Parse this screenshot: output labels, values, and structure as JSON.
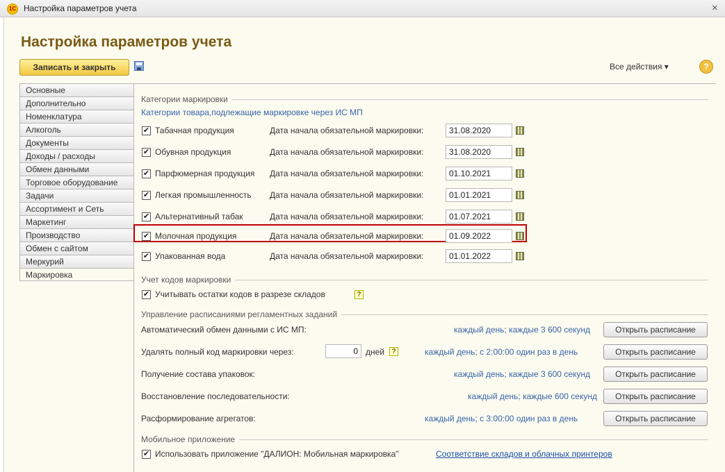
{
  "window": {
    "title": "Настройка параметров учета",
    "close_glyph": "×",
    "logo_text": "1С"
  },
  "form": {
    "title": "Настройка параметров учета"
  },
  "toolbar": {
    "save_close_label": "Записать и закрыть",
    "all_actions_label": "Все действия ▾",
    "help_glyph": "?"
  },
  "tabs": [
    "Основные",
    "Дополнительно",
    "Номенклатура",
    "Алкоголь",
    "Документы",
    "Доходы / расходы",
    "Обмен данными",
    "Торговое оборудование",
    "Задачи",
    "Ассортимент и Сеть",
    "Маркетинг",
    "Производство",
    "Обмен с сайтом",
    "Меркурий",
    "Маркировка"
  ],
  "active_tab": "Маркировка",
  "marking": {
    "section_title": "Категории маркировки",
    "subtitle": "Категории товара,подлежащие маркировке через ИС МП",
    "date_label": "Дата начала обязательной маркировки:",
    "categories": [
      {
        "label": "Табачная продукция",
        "checked": true,
        "date": "31.08.2020"
      },
      {
        "label": "Обувная продукция",
        "checked": true,
        "date": "31.08.2020"
      },
      {
        "label": "Парфюмерная продукция",
        "checked": true,
        "date": "01.10.2021"
      },
      {
        "label": "Легкая промышленность",
        "checked": true,
        "date": "01.01.2021"
      },
      {
        "label": "Альтернативный табак",
        "checked": true,
        "date": "01.07.2021"
      },
      {
        "label": "Молочная продукция",
        "checked": true,
        "date": "01.09.2022"
      },
      {
        "label": "Упакованная вода",
        "checked": true,
        "date": "01.01.2022"
      }
    ]
  },
  "codes": {
    "section_title": "Учет кодов маркировки",
    "checkbox_label": "Учитывать остатки кодов в разрезе складов",
    "checked": true
  },
  "schedules": {
    "section_title": "Управление расписаниями регламентных заданий",
    "button_label": "Открыть расписание",
    "delete_value": "0",
    "days_label": "дней",
    "rows": [
      {
        "label": "Автоматический обмен данными с ИС МП:",
        "schedule": "каждый день; каждые 3 600 секунд"
      },
      {
        "label": "Удалять полный код маркировки через:",
        "schedule": "каждый день; с 2:00:00 один раз в день"
      },
      {
        "label": "Получение состава упаковок:",
        "schedule": "каждый день; каждые 3 600 секунд"
      },
      {
        "label": "Восстановление последовательности:",
        "schedule": "каждый день; каждые 600 секунд"
      },
      {
        "label": "Расформирование агрегатов:",
        "schedule": "каждый день; с 3:00:00 один раз в день"
      }
    ]
  },
  "mobile": {
    "section_title": "Мобильное приложение",
    "checkbox_label": "Использовать приложение \"ДАЛИОН: Мобильная маркировка\"",
    "checked": true,
    "link_label": "Соответствие складов и облачных принтеров"
  },
  "glyphs": {
    "check": "✔"
  },
  "icons": {
    "logo": "1c-logo-icon",
    "save": "floppy-disk-icon",
    "help": "help-circle-icon",
    "calendar": "calendar-icon",
    "hint": "question-hint-icon"
  },
  "colors": {
    "accent_title": "#7a5a13",
    "button_gold": "#f2c840",
    "link_blue": "#1a4fa8",
    "subtitle_blue": "#3863a8",
    "highlight_red": "#c00000",
    "panel_bg": "#fbfbf0"
  }
}
